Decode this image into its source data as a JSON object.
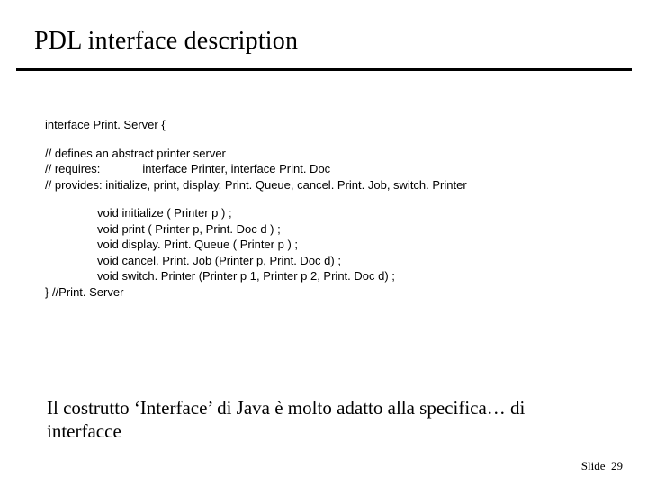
{
  "title": "PDL interface description",
  "code": {
    "l1": "interface Print. Server {",
    "l2": "// defines an abstract printer server",
    "l3": "// requires:             interface Printer, interface Print. Doc",
    "l4": "// provides: initialize, print, display. Print. Queue, cancel. Print. Job, switch. Printer",
    "m1": "void initialize ( Printer p ) ;",
    "m2": "void print ( Printer p, Print. Doc d ) ;",
    "m3": "void display. Print. Queue ( Printer p ) ;",
    "m4": "void cancel. Print. Job (Printer p, Print. Doc d) ;",
    "m5": "void switch. Printer (Printer p 1, Printer p 2, Print. Doc d) ;",
    "l_end": "} //Print. Server"
  },
  "bottom": "Il costrutto ‘Interface’ di Java è molto adatto alla specifica… di interfacce",
  "footer": {
    "label": "Slide",
    "num": "29"
  }
}
